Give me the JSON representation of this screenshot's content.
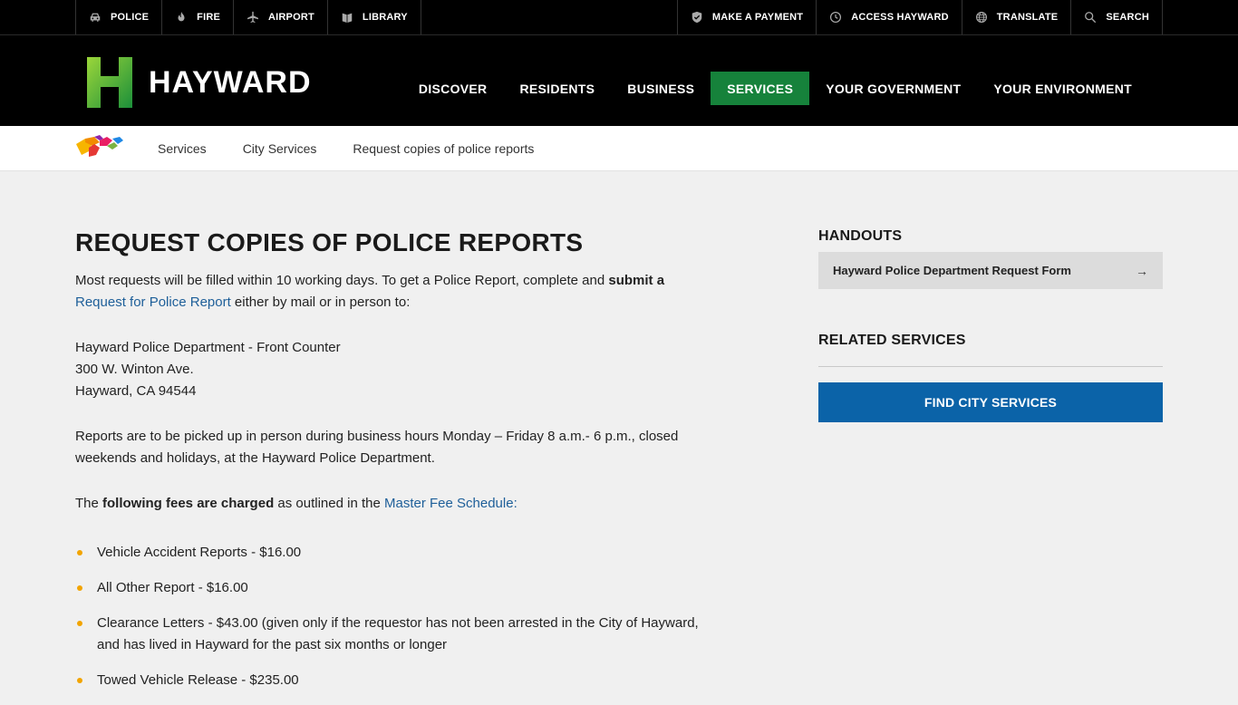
{
  "utility": {
    "left": [
      {
        "label": "POLICE",
        "icon": "police-car-icon"
      },
      {
        "label": "FIRE",
        "icon": "fire-icon"
      },
      {
        "label": "AIRPORT",
        "icon": "airplane-icon"
      },
      {
        "label": "LIBRARY",
        "icon": "book-icon"
      }
    ],
    "right": [
      {
        "label": "MAKE A PAYMENT",
        "icon": "shield-check-icon"
      },
      {
        "label": "ACCESS HAYWARD",
        "icon": "clock-icon"
      },
      {
        "label": "TRANSLATE",
        "icon": "globe-icon"
      },
      {
        "label": "SEARCH",
        "icon": "search-icon"
      }
    ]
  },
  "header": {
    "logo_text": "HAYWARD",
    "nav": [
      "DISCOVER",
      "RESIDENTS",
      "BUSINESS",
      "SERVICES",
      "YOUR GOVERNMENT",
      "YOUR ENVIRONMENT"
    ],
    "active_nav": "SERVICES",
    "active_color": "#16823b"
  },
  "breadcrumb": [
    "Services",
    "City Services",
    "Request copies of police reports"
  ],
  "main": {
    "title": "REQUEST COPIES OF POLICE REPORTS",
    "intro_1": "Most requests will be filled within 10 working days. To get a Police Report, complete and ",
    "intro_bold": "submit a",
    "intro_link": "Request for Police Report",
    "intro_2": " either by mail or in person to:",
    "address": [
      "Hayward Police Department - Front Counter",
      "300 W. Winton Ave.",
      "Hayward, CA 94544"
    ],
    "pickup": "Reports are to be picked up in person during business hours Monday – Friday 8 a.m.- 6 p.m., closed weekends and holidays, at the Hayward Police Department.",
    "fees_1": "The ",
    "fees_bold": "following fees are charged",
    "fees_2": " as outlined in the ",
    "fees_link": "Master Fee Schedule",
    "fees_3": ":",
    "fees": [
      "Vehicle Accident Reports - $16.00",
      "All Other Report - $16.00",
      "Clearance Letters - $43.00 (given only if the requestor has not been arrested in the City of Hayward, and has lived in Hayward for the past six months or longer",
      "Towed Vehicle Release - $235.00"
    ]
  },
  "aside": {
    "handouts_title": "HANDOUTS",
    "handout_label": "Hayward Police Department Request Form",
    "handout_arrow": "→",
    "related_title": "RELATED SERVICES",
    "find_button": "FIND CITY SERVICES",
    "button_color": "#0b63a8"
  }
}
